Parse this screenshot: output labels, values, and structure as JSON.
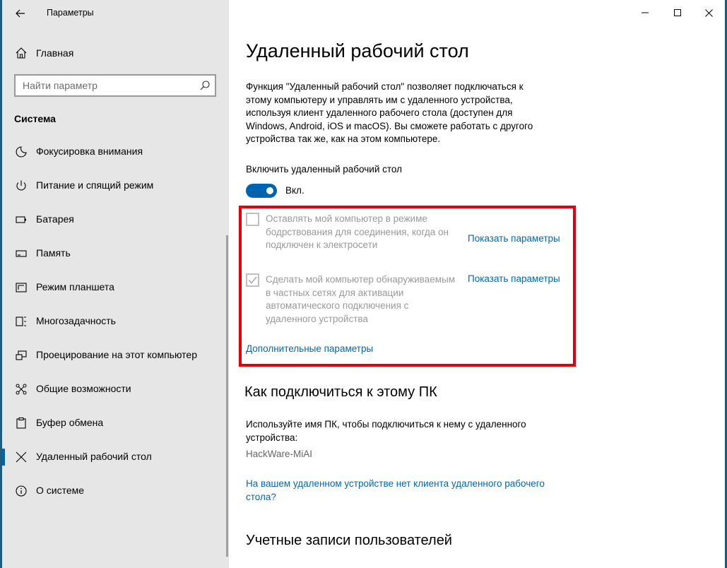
{
  "window": {
    "title": "Параметры"
  },
  "sidebar": {
    "home_label": "Главная",
    "search_placeholder": "Найти параметр",
    "section_title": "Система",
    "items": [
      {
        "label": "Фокусировка внимания",
        "icon": "moon-icon"
      },
      {
        "label": "Питание и спящий режим",
        "icon": "power-icon"
      },
      {
        "label": "Батарея",
        "icon": "battery-icon"
      },
      {
        "label": "Память",
        "icon": "storage-icon"
      },
      {
        "label": "Режим планшета",
        "icon": "tablet-icon"
      },
      {
        "label": "Многозадачность",
        "icon": "multitask-icon"
      },
      {
        "label": "Проецирование на этот компьютер",
        "icon": "project-icon"
      },
      {
        "label": "Общие возможности",
        "icon": "shared-icon"
      },
      {
        "label": "Буфер обмена",
        "icon": "clipboard-icon"
      },
      {
        "label": "Удаленный рабочий стол",
        "icon": "remote-desktop-icon",
        "selected": true
      },
      {
        "label": "О системе",
        "icon": "info-icon"
      }
    ]
  },
  "main": {
    "title": "Удаленный рабочий стол",
    "description": "Функция \"Удаленный рабочий стол\" позволяет подключаться к этому компьютеру и управлять им с удаленного устройства, используя клиент удаленного рабочего стола (доступен для Windows, Android, iOS и macOS). Вы сможете работать с другого устройства так же, как на этом компьютере.",
    "toggle": {
      "label": "Включить удаленный рабочий стол",
      "state_text": "Вкл.",
      "on": true
    },
    "options": [
      {
        "text": "Оставлять мой компьютер в режиме бодрствования для соединения, когда он подключен к электросети",
        "checked": false,
        "link": "Показать параметры"
      },
      {
        "text": "Сделать мой компьютер обнаруживаемым в частных сетях для активации автоматического подключения с удаленного устройства",
        "checked": true,
        "link": "Показать параметры"
      }
    ],
    "advanced_link": "Дополнительные параметры",
    "connect_section": {
      "heading": "Как подключиться к этому ПК",
      "text": "Используйте имя ПК, чтобы подключиться к нему с удаленного устройства:",
      "pc_name": "HackWare-MiAI",
      "no_client_link": "На вашем удаленном устройстве нет клиента удаленного рабочего стола?"
    },
    "accounts_heading": "Учетные записи пользователей"
  },
  "colors": {
    "accent": "#0063b1",
    "link": "#0067b8",
    "highlight_box": "#e3000b",
    "sidebar_bg": "#e6e6e6"
  }
}
